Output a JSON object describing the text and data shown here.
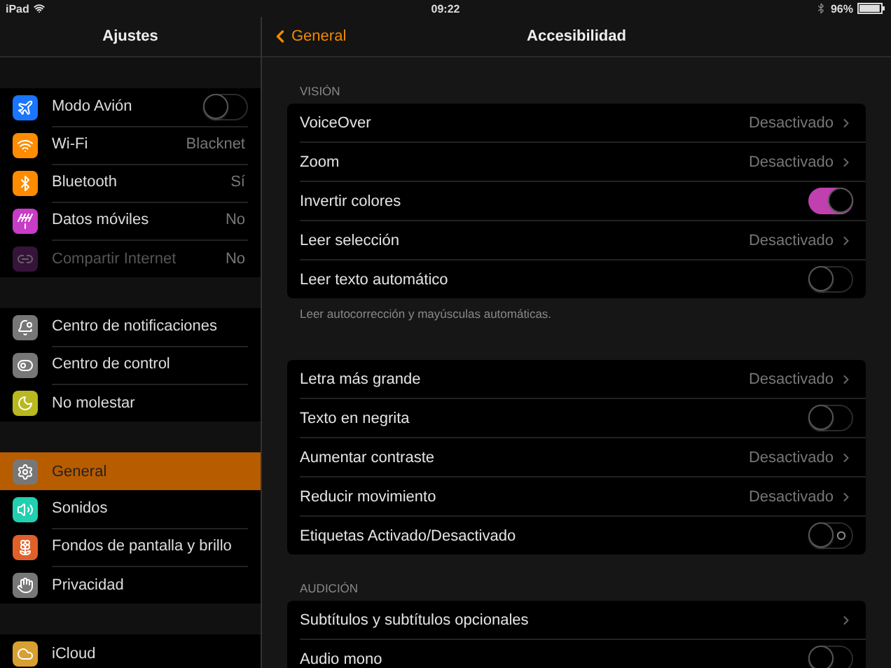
{
  "status_bar": {
    "device": "iPad",
    "time": "09:22",
    "battery": "96%"
  },
  "sidebar": {
    "title": "Ajustes",
    "groups": [
      {
        "items": [
          {
            "label": "Modo Avión",
            "kind": "toggle",
            "on": false,
            "disabled": false,
            "selected": false
          },
          {
            "label": "Wi-Fi",
            "kind": "value",
            "value": "Blacknet",
            "disabled": false,
            "selected": false
          },
          {
            "label": "Bluetooth",
            "kind": "value",
            "value": "Sí",
            "disabled": false,
            "selected": false
          },
          {
            "label": "Datos móviles",
            "kind": "value",
            "value": "No",
            "disabled": false,
            "selected": false
          },
          {
            "label": "Compartir Internet",
            "kind": "value",
            "value": "No",
            "disabled": true,
            "selected": false
          }
        ]
      },
      {
        "items": [
          {
            "label": "Centro de notificaciones",
            "kind": "plain",
            "disabled": false,
            "selected": false
          },
          {
            "label": "Centro de control",
            "kind": "plain",
            "disabled": false,
            "selected": false
          },
          {
            "label": "No molestar",
            "kind": "plain",
            "disabled": false,
            "selected": false
          }
        ]
      },
      {
        "items": [
          {
            "label": "General",
            "kind": "plain",
            "disabled": false,
            "selected": true
          },
          {
            "label": "Sonidos",
            "kind": "plain",
            "disabled": false,
            "selected": false
          },
          {
            "label": "Fondos de pantalla y brillo",
            "kind": "plain",
            "disabled": false,
            "selected": false
          },
          {
            "label": "Privacidad",
            "kind": "plain",
            "disabled": false,
            "selected": false
          }
        ]
      },
      {
        "items": [
          {
            "label": "iCloud",
            "kind": "plain",
            "disabled": false,
            "selected": false
          }
        ]
      }
    ]
  },
  "detail": {
    "back": "General",
    "title": "Accesibilidad",
    "sections": [
      {
        "header": "VISIÓN",
        "footer": "Leer autocorrección y mayúsculas automáticas.",
        "rows": [
          {
            "label": "VoiceOver",
            "kind": "link",
            "value": "Desactivado"
          },
          {
            "label": "Zoom",
            "kind": "link",
            "value": "Desactivado"
          },
          {
            "label": "Invertir colores",
            "kind": "toggle",
            "on": true
          },
          {
            "label": "Leer selección",
            "kind": "link",
            "value": "Desactivado"
          },
          {
            "label": "Leer texto automático",
            "kind": "toggle",
            "on": false
          }
        ]
      },
      {
        "rows": [
          {
            "label": "Letra más grande",
            "kind": "link",
            "value": "Desactivado"
          },
          {
            "label": "Texto en negrita",
            "kind": "toggle",
            "on": false
          },
          {
            "label": "Aumentar contraste",
            "kind": "link",
            "value": "Desactivado"
          },
          {
            "label": "Reducir movimiento",
            "kind": "link",
            "value": "Desactivado"
          },
          {
            "label": "Etiquetas Activado/Desactivado",
            "kind": "toggle",
            "on": false,
            "on_off_labels": true
          }
        ]
      },
      {
        "header": "AUDICIÓN",
        "rows": [
          {
            "label": "Subtítulos y subtítulos opcionales",
            "kind": "link"
          },
          {
            "label": "Audio mono",
            "kind": "toggle",
            "on": false
          },
          {
            "kind": "blank"
          }
        ]
      }
    ]
  }
}
